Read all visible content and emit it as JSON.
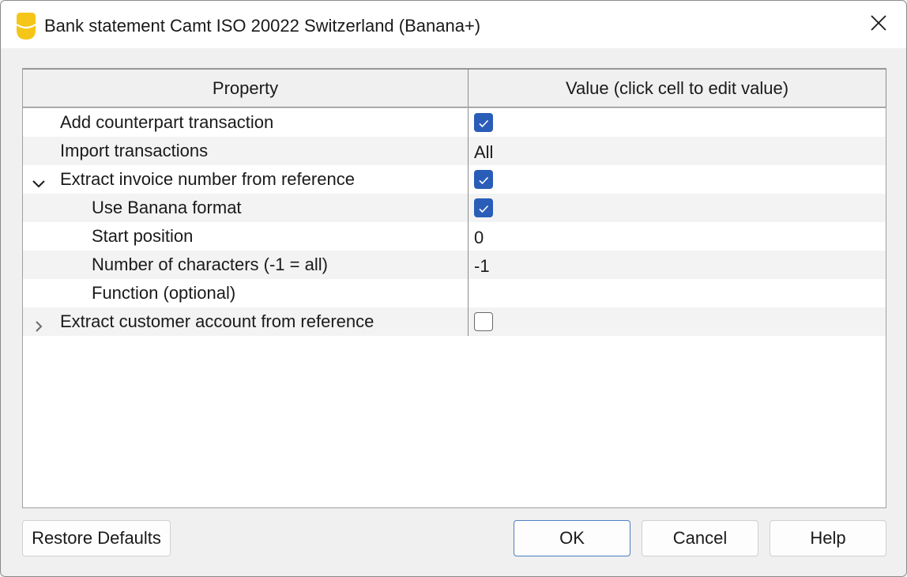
{
  "window": {
    "title": "Bank statement Camt ISO 20022 Switzerland (Banana+)",
    "app_icon": "banana-app-icon",
    "close_icon": "close-icon"
  },
  "table": {
    "headers": {
      "property": "Property",
      "value": "Value (click cell to edit value)"
    },
    "rows": [
      {
        "label": "Add counterpart transaction",
        "value": "",
        "checked": true
      },
      {
        "label": "Import transactions",
        "value": "All"
      },
      {
        "label": "Extract invoice number from reference",
        "value": "",
        "checked": true,
        "expanded": true
      },
      {
        "label": "Use Banana format",
        "value": "",
        "checked": true
      },
      {
        "label": "Start position",
        "value": "0"
      },
      {
        "label": "Number of characters (-1 = all)",
        "value": "-1"
      },
      {
        "label": "Function (optional)",
        "value": ""
      },
      {
        "label": "Extract customer account from reference",
        "value": "",
        "checked": false,
        "expanded": false
      }
    ]
  },
  "buttons": {
    "restore_defaults": "Restore Defaults",
    "ok": "OK",
    "cancel": "Cancel",
    "help": "Help"
  },
  "colors": {
    "checkbox_checked": "#2a5db8",
    "app_icon": "#f5c518",
    "default_button_border": "#4b7fc4"
  }
}
